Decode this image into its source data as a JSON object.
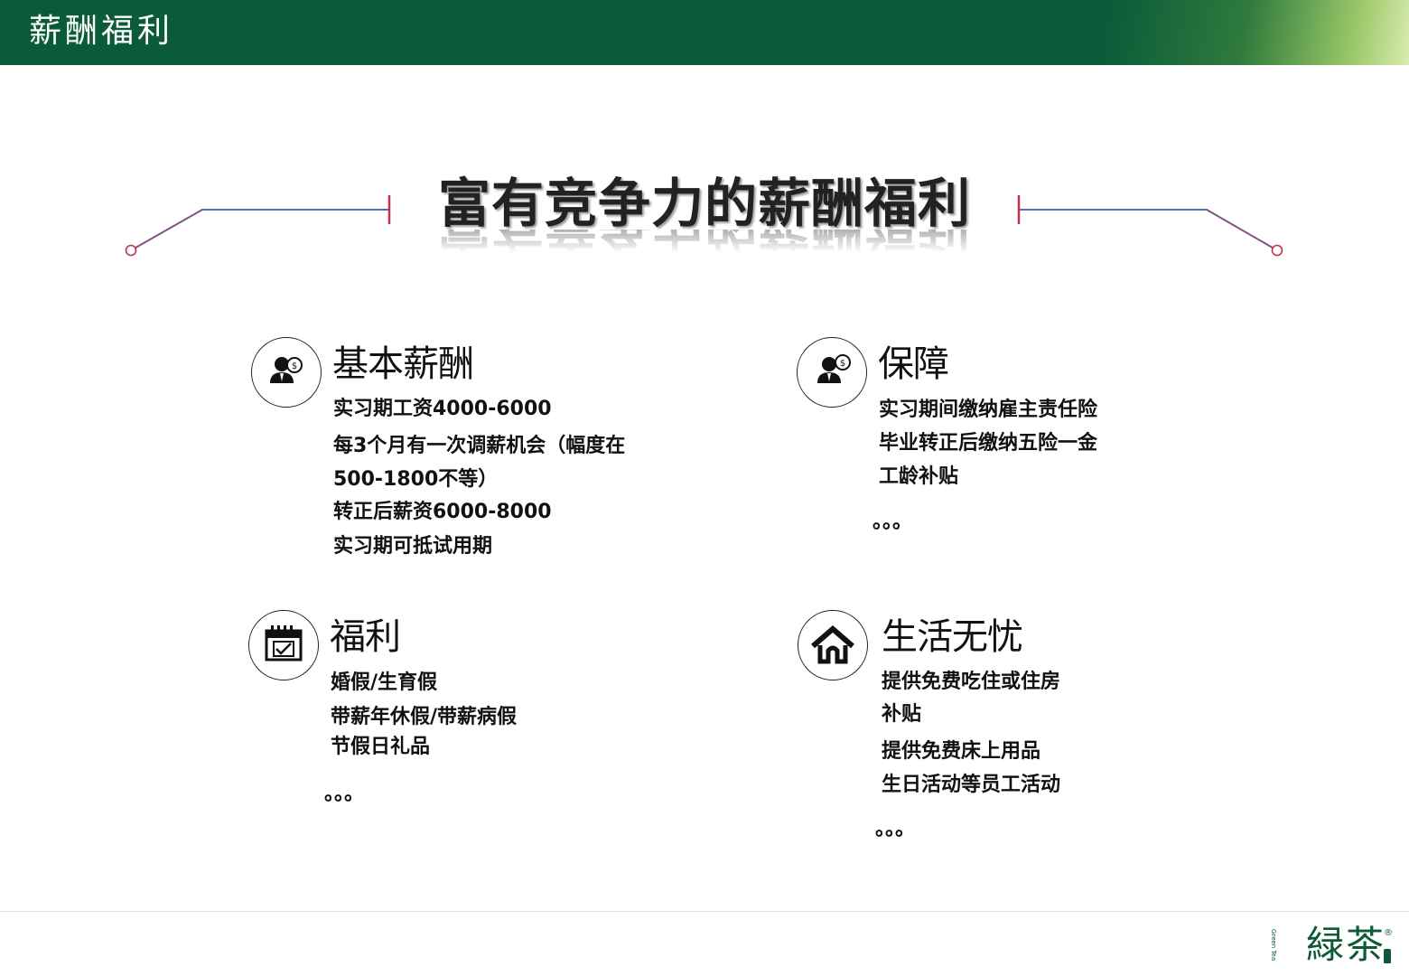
{
  "header": {
    "title": "薪酬福利"
  },
  "main_title": "富有竞争力的薪酬福利",
  "colors": {
    "header_green": "#0b5a3a",
    "deco_blue": "#4f6fb8",
    "deco_red": "#c0344a",
    "logo_green": "#0f5a36"
  },
  "sections": {
    "base_salary": {
      "icon": "person-dollar-icon",
      "title": "基本薪酬",
      "lines": [
        "实习期工资4000-6000",
        "每3个月有一次调薪机会（幅度在",
        "500-1800不等）",
        "转正后薪资6000-8000",
        "实习期可抵试用期"
      ]
    },
    "insurance": {
      "icon": "person-dollar-icon",
      "title": "保障",
      "lines": [
        "实习期间缴纳雇主责任险",
        "毕业转正后缴纳五险一金",
        "工龄补贴",
        "。。。"
      ]
    },
    "welfare": {
      "icon": "calendar-check-icon",
      "title": "福利",
      "lines": [
        "婚假/生育假",
        "带薪年休假/带薪病假",
        "节假日礼品",
        "。。。"
      ]
    },
    "living": {
      "icon": "house-icon",
      "title": "生活无忧",
      "lines": [
        "提供免费吃住或住房",
        "补贴",
        "提供免费床上用品",
        "生日活动等员工活动",
        "。。。"
      ]
    }
  },
  "logo": {
    "text": "緑茶",
    "tag": "Green Tea",
    "reg": "®"
  }
}
